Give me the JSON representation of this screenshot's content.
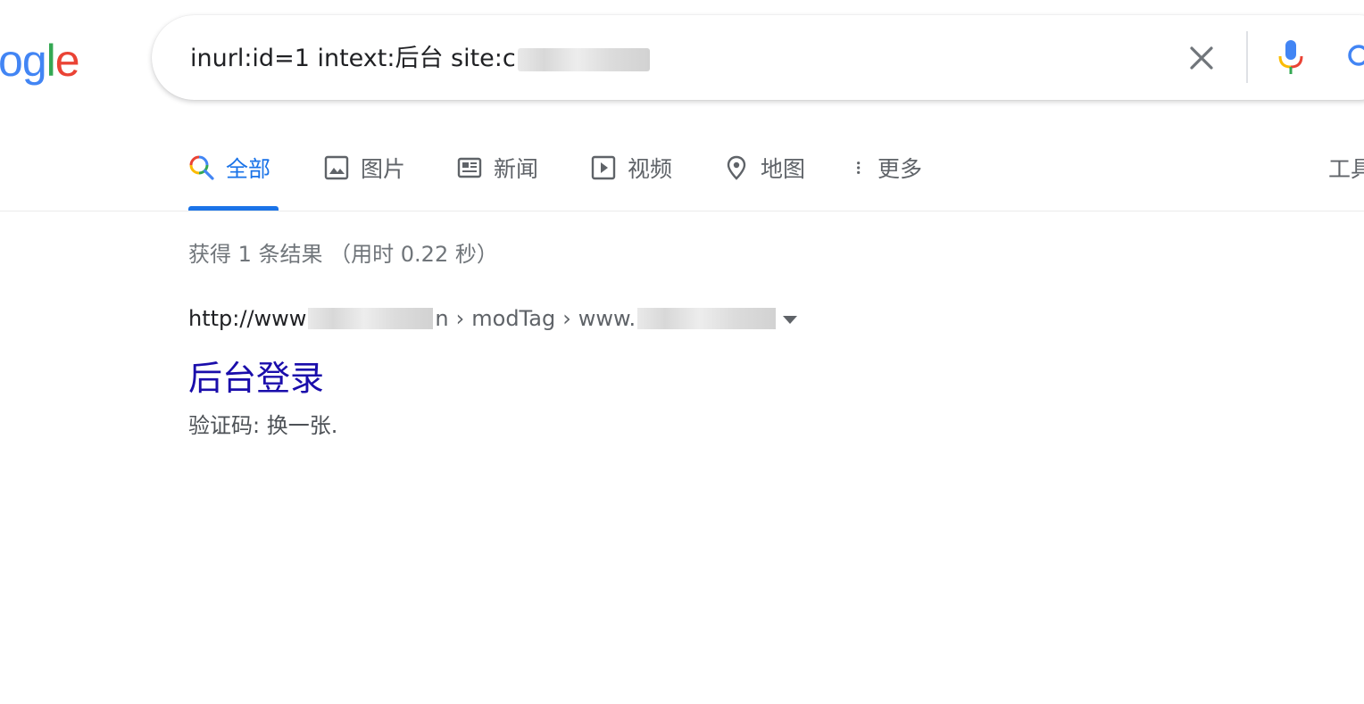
{
  "logo": {
    "letters": [
      "o",
      "g",
      "l",
      "e"
    ]
  },
  "colors": {
    "google_blue": "#4285F4",
    "google_red": "#EA4335",
    "google_yellow": "#FBBC05",
    "google_green": "#34A853",
    "active_tab": "#1a73e8",
    "result_title": "#1a0dab"
  },
  "search": {
    "query_prefix": "inurl:id=1  intext:后台 site:",
    "query_suffix_visible": "c",
    "icons": {
      "clear": "close-icon",
      "voice": "mic-icon",
      "submit": "search-icon"
    }
  },
  "tabs": [
    {
      "label": "全部",
      "icon": "search-icon",
      "active": true
    },
    {
      "label": "图片",
      "icon": "image-icon",
      "active": false
    },
    {
      "label": "新闻",
      "icon": "news-icon",
      "active": false
    },
    {
      "label": "视频",
      "icon": "video-icon",
      "active": false
    },
    {
      "label": "地图",
      "icon": "map-pin-icon",
      "active": false
    },
    {
      "label": "更多",
      "icon": "more-vert-icon",
      "active": false
    }
  ],
  "tools_label": "工具",
  "results": {
    "stats": "获得 1 条结果 （用时 0.22 秒）",
    "items": [
      {
        "cite_prefix": "http://www",
        "cite_mid_tail": "n",
        "cite_separator": "›",
        "cite_path1": "modTag",
        "cite_path2_prefix": "www.",
        "title": "后台登录",
        "snippet": "验证码: 换一张."
      }
    ]
  }
}
